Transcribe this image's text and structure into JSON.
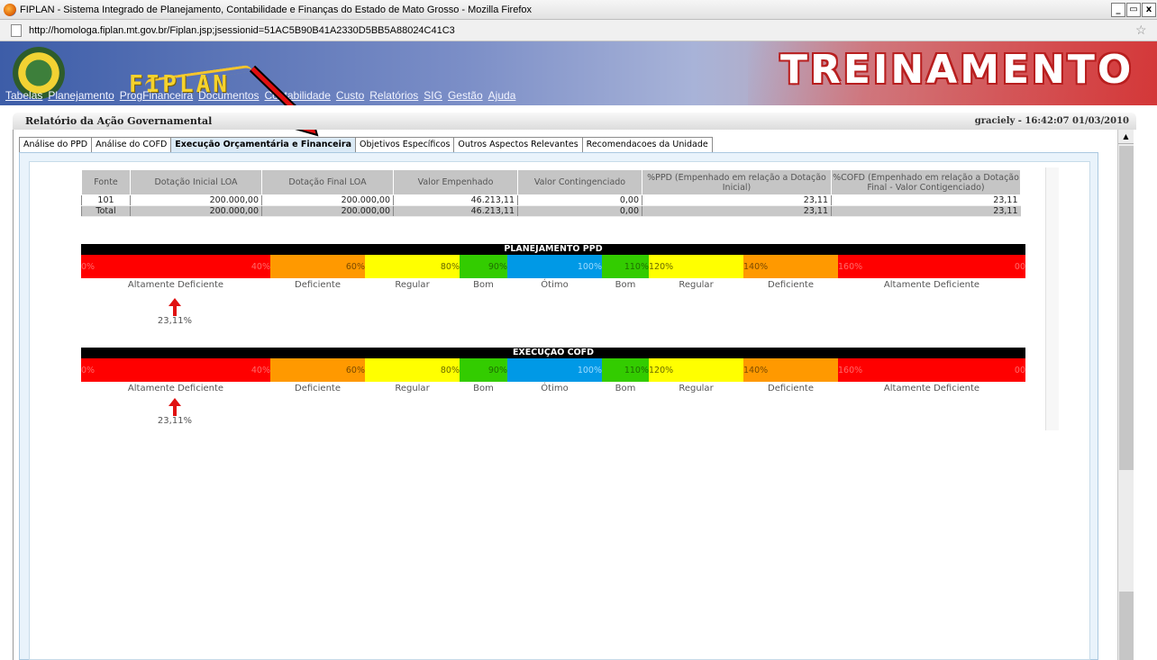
{
  "window": {
    "title": "FIPLAN - Sistema Integrado de Planejamento, Contabilidade e Finanças do Estado de Mato Grosso - Mozilla Firefox",
    "buttons": [
      "_",
      "̅̅",
      "x"
    ]
  },
  "address": {
    "url": "http://homologa.fiplan.mt.gov.br/Fiplan.jsp;jsessionid=51AC5B90B41A2330D5BB5A88024C41C3"
  },
  "banner": {
    "logo_text": "FIPLAN",
    "env_label": "TREINAMENTO"
  },
  "menu": [
    "Tabelas",
    "Planejamento",
    "ProgFinanceira",
    "Documentos",
    "Contabilidade",
    "Custo",
    "Relatórios",
    "SIG",
    "Gestão",
    "Ajuda"
  ],
  "page": {
    "title": "Relatório da Ação Governamental",
    "user_info": "graciely - 16:42:07 01/03/2010"
  },
  "tabs": [
    {
      "label": "Análise do PPD",
      "active": false
    },
    {
      "label": "Análise do COFD",
      "active": false
    },
    {
      "label": "Execução Orçamentária e Financeira",
      "active": true
    },
    {
      "label": "Objetivos Específicos",
      "active": false
    },
    {
      "label": "Outros Aspectos Relevantes",
      "active": false
    },
    {
      "label": "Recomendacoes da Unidade",
      "active": false
    }
  ],
  "table": {
    "headers": [
      "Fonte",
      "Dotação Inicial LOA",
      "Dotação Final LOA",
      "Valor Empenhado",
      "Valor Contingenciado",
      "%PPD (Empenhado em relação a Dotação Inicial)",
      "%COFD (Empenhado em relação a Dotação Final - Valor Contigenciado)"
    ],
    "rows": [
      [
        "101",
        "200.000,00",
        "200.000,00",
        "46.213,11",
        "0,00",
        "23,11",
        "23,11"
      ],
      [
        "Total",
        "200.000,00",
        "200.000,00",
        "46.213,11",
        "0,00",
        "23,11",
        "23,11"
      ]
    ]
  },
  "scales": [
    {
      "title": "PLANEJAMENTO PPD",
      "marker_label": "23,11%",
      "marker_value_percent": 23.11
    },
    {
      "title": "EXECUÇÃO COFD",
      "marker_label": "23,11%",
      "marker_value_percent": 23.11
    }
  ],
  "scale_segments": [
    {
      "color": "#ff0000",
      "left": "0%",
      "right": "40%",
      "text_color": "#ff6a6a"
    },
    {
      "color": "#ff9900",
      "left": "",
      "right": "60%",
      "text_color": "#7a4a00"
    },
    {
      "color": "#ffff00",
      "left": "",
      "right": "80%",
      "text_color": "#6a6a00"
    },
    {
      "color": "#33cc00",
      "left": "",
      "right": "90%",
      "text_color": "#1f6f00"
    },
    {
      "color": "#0099e6",
      "left": "",
      "right": "100%",
      "text_color": "#9fdcff"
    },
    {
      "color": "#33cc00",
      "left": "",
      "right": "110%",
      "text_color": "#1f6f00"
    },
    {
      "color": "#ffff00",
      "left": "120%",
      "right": "",
      "text_color": "#6a6a00"
    },
    {
      "color": "#ff9900",
      "left": "140%",
      "right": "",
      "text_color": "#7a4a00"
    },
    {
      "color": "#ff0000",
      "left": "160%",
      "right": "00",
      "text_color": "#ff6a6a"
    }
  ],
  "scale_labels": [
    "Altamente Deficiente",
    "Deficiente",
    "Regular",
    "Bom",
    "Ótimo",
    "Bom",
    "Regular",
    "Deficiente",
    "Altamente Deficiente"
  ]
}
